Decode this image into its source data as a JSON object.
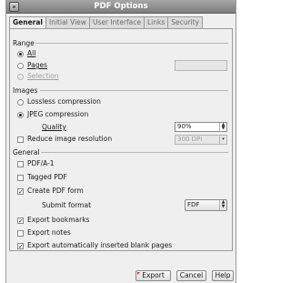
{
  "window": {
    "title": "PDF Options"
  },
  "tabs": [
    "General",
    "Initial View",
    "User Interface",
    "Links",
    "Security"
  ],
  "range": {
    "heading": "Range",
    "all": "All",
    "pages": "Pages",
    "selection": "Selection"
  },
  "images": {
    "heading": "Images",
    "lossless": "Lossless compression",
    "jpeg": "JPEG compression",
    "quality_label": "Quality",
    "quality_value": "90%",
    "reduce": "Reduce image resolution",
    "resolution_value": "300 DPI"
  },
  "general": {
    "heading": "General",
    "pdfa": "PDF/A-1",
    "tagged": "Tagged PDF",
    "create_form": "Create PDF form",
    "submit_format_label": "Submit format",
    "submit_format_value": "FDF",
    "bookmarks": "Export bookmarks",
    "notes": "Export notes",
    "blank_pages": "Export automatically inserted blank pages"
  },
  "buttons": {
    "export": "Export",
    "cancel": "Cancel",
    "help": "Help"
  },
  "checks": {
    "create_form": "✓",
    "bookmarks": "✓",
    "blank_pages": "✓"
  }
}
